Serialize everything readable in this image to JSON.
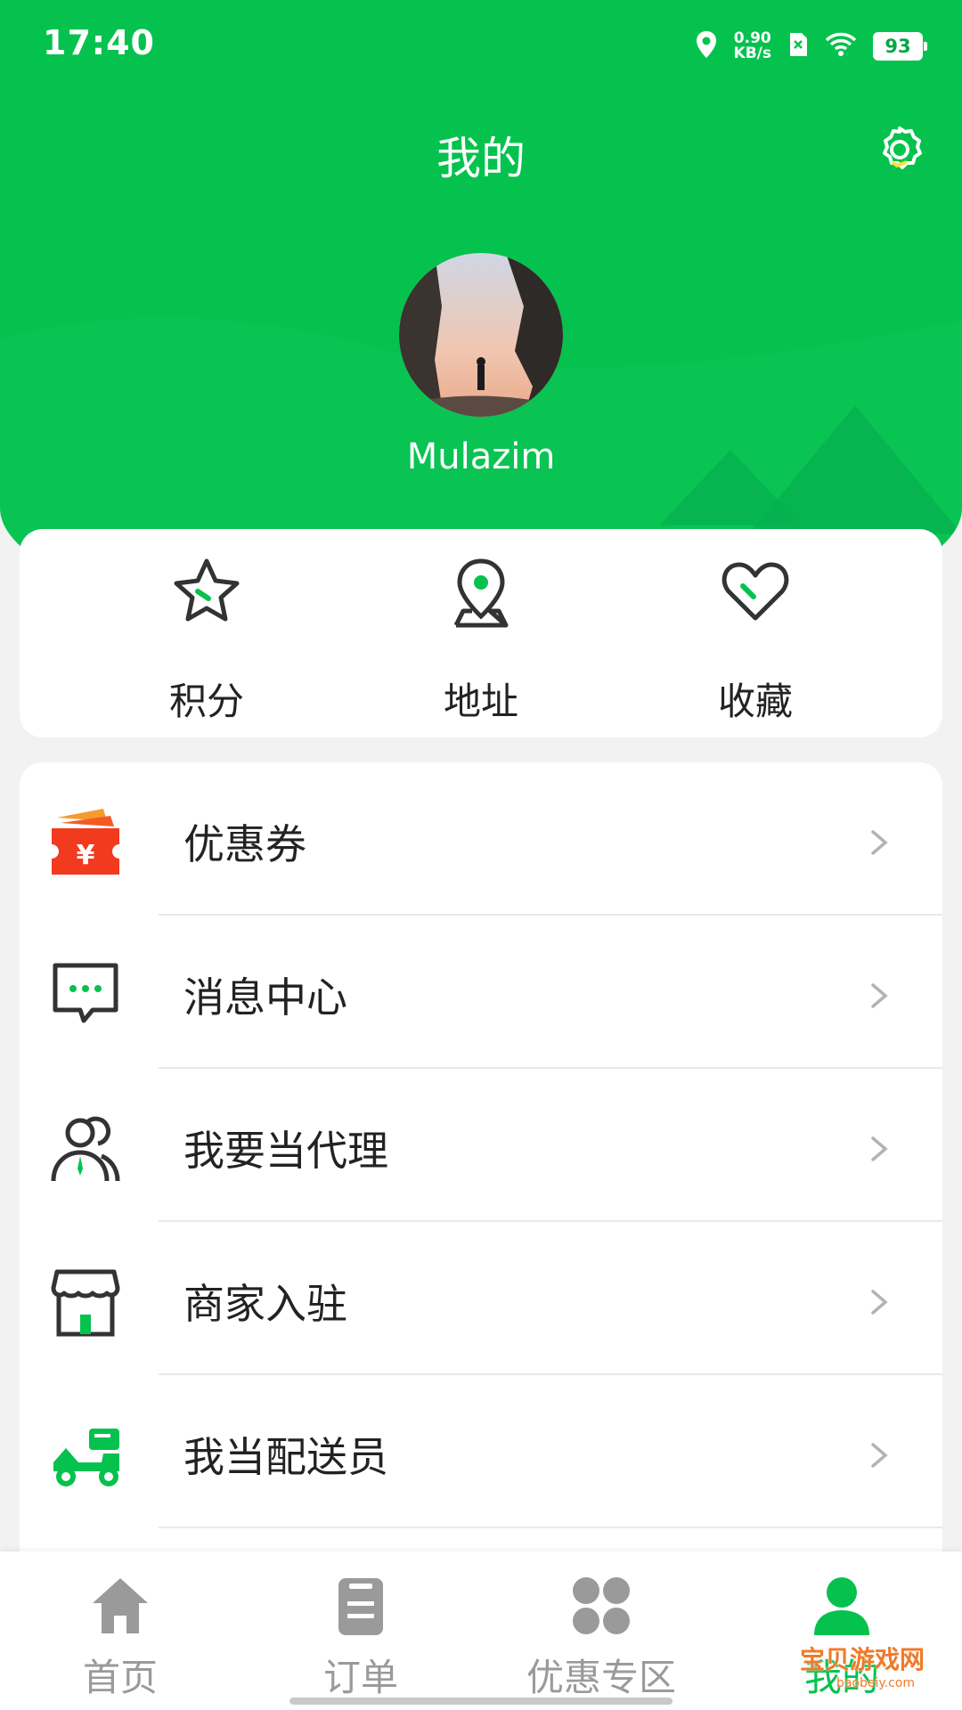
{
  "status": {
    "time": "17:40",
    "speed_value": "0.90",
    "speed_unit": "KB/s",
    "battery": "93"
  },
  "header": {
    "title": "我的"
  },
  "profile": {
    "username": "Mulazim"
  },
  "quick_actions": [
    {
      "label": "积分",
      "icon": "star-icon"
    },
    {
      "label": "地址",
      "icon": "location-pin-icon"
    },
    {
      "label": "收藏",
      "icon": "heart-icon"
    }
  ],
  "menu": [
    {
      "label": "优惠券",
      "icon": "coupon-icon"
    },
    {
      "label": "消息中心",
      "icon": "message-icon"
    },
    {
      "label": "我要当代理",
      "icon": "agent-icon"
    },
    {
      "label": "商家入驻",
      "icon": "store-icon"
    },
    {
      "label": "我当配送员",
      "icon": "delivery-scooter-icon"
    }
  ],
  "tabbar": [
    {
      "label": "首页",
      "icon": "home-icon",
      "active": false
    },
    {
      "label": "订单",
      "icon": "order-icon",
      "active": false
    },
    {
      "label": "优惠专区",
      "icon": "deals-grid-icon",
      "active": false
    },
    {
      "label": "我的",
      "icon": "profile-icon",
      "active": true
    }
  ],
  "watermark": {
    "text": "宝贝游戏网",
    "sub": "baobeiy.com"
  },
  "colors": {
    "brand_green": "#05c24e",
    "coupon_red": "#f23a1e",
    "text_dark": "#222222",
    "tab_inactive": "#9a9a9a"
  }
}
